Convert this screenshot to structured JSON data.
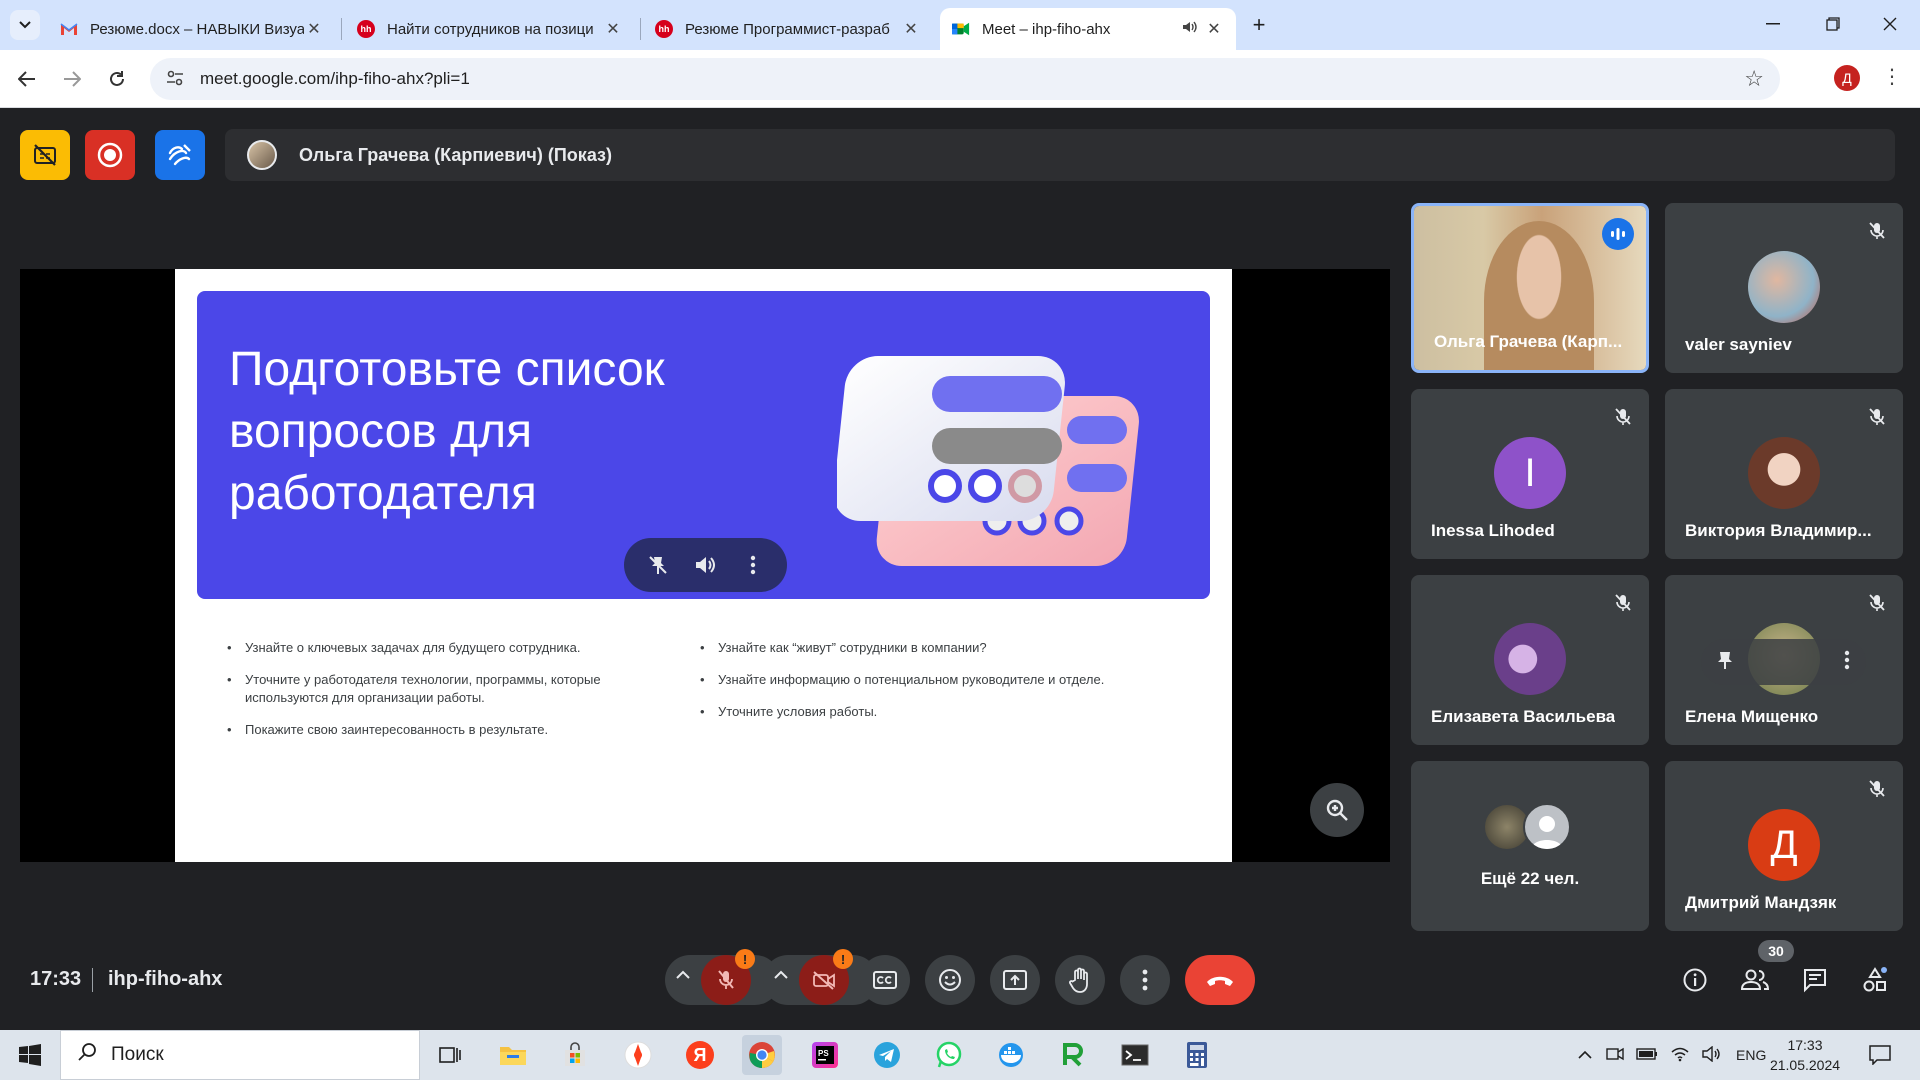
{
  "browser": {
    "tabs": [
      {
        "title": "Резюме.docx – НАВЫКИ Визуа",
        "favicon": "gmail-icon",
        "active": false
      },
      {
        "title": "Найти сотрудников на позици",
        "favicon": "hh-icon",
        "active": false
      },
      {
        "title": "Резюме Программист-разраб",
        "favicon": "hh-icon",
        "active": false
      },
      {
        "title": "Meet – ihp-fiho-ahx",
        "favicon": "meet-icon",
        "active": true
      }
    ],
    "url": "meet.google.com/ihp-fiho-ahx?pli=1",
    "profile_initial": "Д"
  },
  "meet": {
    "presenter_label": "Ольга Грачева (Карпиевич) (Показ)",
    "meeting_time": "17:33",
    "meeting_code": "ihp-fiho-ahx",
    "participant_count": "30",
    "slide": {
      "title": "Подготовьте список вопросов для работодателя",
      "bullets_left": [
        "Узнайте о ключевых задачах для будущего сотрудника.",
        "Уточните у работодателя технологии, программы, которые используются для организации работы.",
        "Покажите свою заинтересованность в результате."
      ],
      "bullets_right": [
        "Узнайте как “живут” сотрудники в компании?",
        "Узнайте информацию о потенциальном руководителе и отделе.",
        "Уточните условия работы."
      ]
    },
    "participants": [
      {
        "name": "Ольга Грачева (Карп...",
        "type": "video",
        "speaking": true
      },
      {
        "name": "valer sayniev",
        "type": "photo",
        "muted": true
      },
      {
        "name": "Inessa Lihoded",
        "type": "initial",
        "initial": "I",
        "color": "#8e52c9",
        "muted": true
      },
      {
        "name": "Виктория Владимир...",
        "type": "photo",
        "muted": true
      },
      {
        "name": "Елизавета Васильева",
        "type": "photo",
        "muted": true
      },
      {
        "name": "Елена Мищенко",
        "type": "photo",
        "muted": true
      },
      {
        "name": "Ещё 22 чел.",
        "type": "more"
      },
      {
        "name": "Дмитрий Мандзяк",
        "type": "initial",
        "initial": "Д",
        "color": "#d93c14",
        "muted": true
      }
    ]
  },
  "taskbar": {
    "search_placeholder": "Поиск",
    "language": "ENG",
    "time": "17:33",
    "date": "21.05.2024"
  },
  "colors": {
    "meet_bg": "#202124",
    "tile_bg": "#3c4043",
    "slide_banner": "#4b47e8",
    "end_call": "#ea4335",
    "speaking_border": "#8ab4f8"
  }
}
